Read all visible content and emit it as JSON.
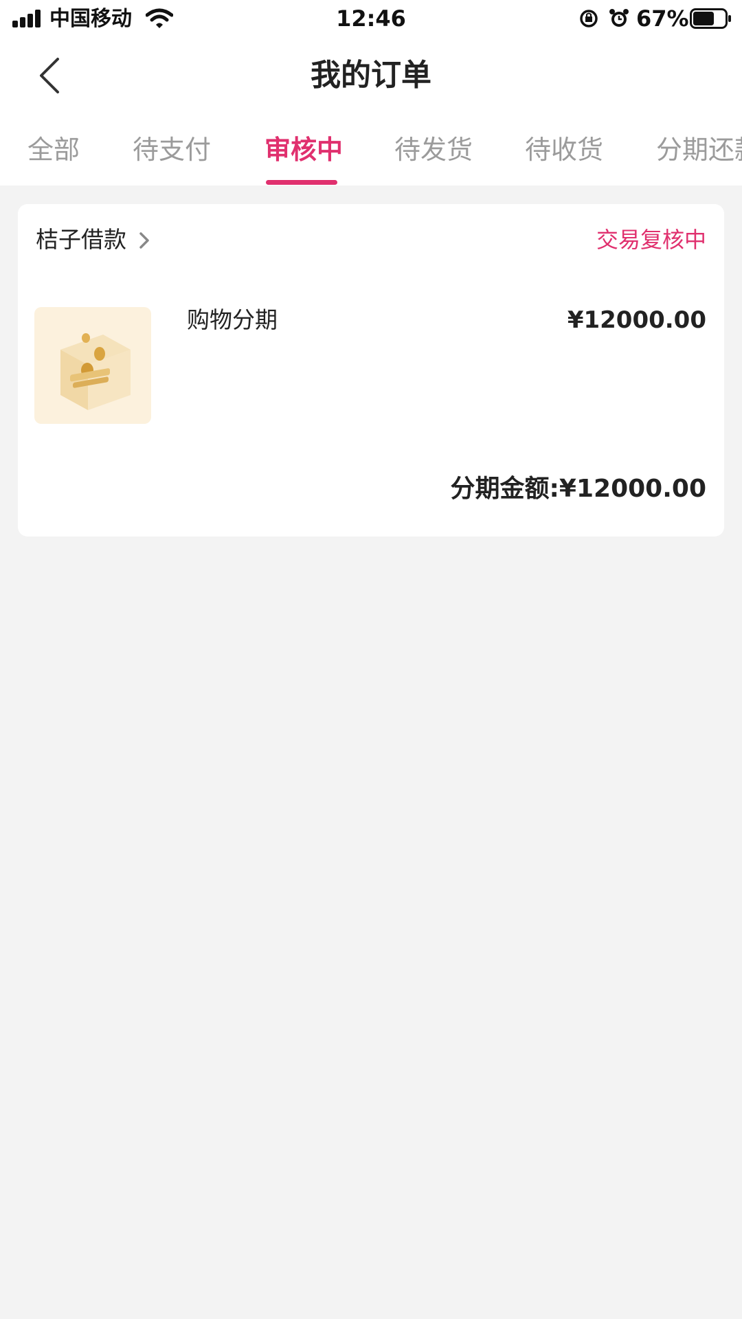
{
  "status_bar": {
    "carrier": "中国移动",
    "time": "12:46",
    "battery_percent": "67%",
    "battery_level": 0.67
  },
  "nav": {
    "back_icon": "chevron-left-icon",
    "title": "我的订单"
  },
  "tabs": [
    {
      "label": "全部",
      "active": false
    },
    {
      "label": "待支付",
      "active": false
    },
    {
      "label": "审核中",
      "active": true
    },
    {
      "label": "待发货",
      "active": false
    },
    {
      "label": "待收货",
      "active": false
    },
    {
      "label": "分期还款",
      "active": false
    }
  ],
  "order": {
    "merchant": "桔子借款",
    "status": "交易复核中",
    "product_name": "购物分期",
    "price": "¥12000.00",
    "total_label": "分期金额:¥12000.00"
  },
  "colors": {
    "accent": "#e0306e",
    "background": "#f3f3f3",
    "tab_inactive": "#9b9b9b"
  }
}
